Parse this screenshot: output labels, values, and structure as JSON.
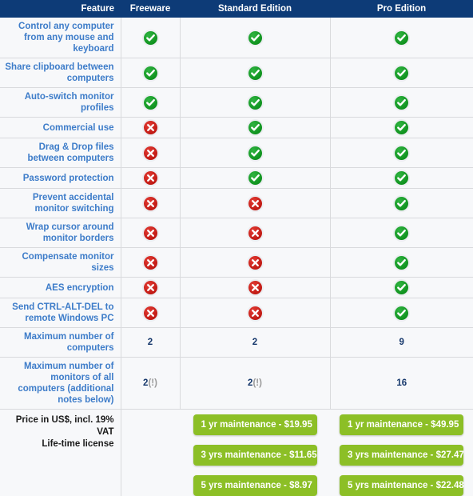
{
  "table": {
    "headers": [
      {
        "label": "Feature",
        "name": "feature"
      },
      {
        "label": "Freeware",
        "name": "freeware"
      },
      {
        "label": "Standard Edition",
        "name": "standard-edition"
      },
      {
        "label": "Pro Edition",
        "name": "pro-edition"
      }
    ],
    "rows": [
      {
        "feature": "Control any computer from any mouse and keyboard",
        "freeware": "check-icon",
        "standard": "check-icon",
        "pro": "check-icon"
      },
      {
        "feature": "Share clipboard between computers",
        "freeware": "check-icon",
        "standard": "check-icon",
        "pro": "check-icon"
      },
      {
        "feature": "Auto-switch monitor profiles",
        "freeware": "check-icon",
        "standard": "check-icon",
        "pro": "check-icon"
      },
      {
        "feature": "Commercial use",
        "freeware": "cross-icon",
        "standard": "check-icon",
        "pro": "check-icon"
      },
      {
        "feature": "Drag & Drop files between computers",
        "freeware": "cross-icon",
        "standard": "check-icon",
        "pro": "check-icon"
      },
      {
        "feature": "Password protection",
        "freeware": "cross-icon",
        "standard": "check-icon",
        "pro": "check-icon"
      },
      {
        "feature": "Prevent accidental monitor switching",
        "freeware": "cross-icon",
        "standard": "cross-icon",
        "pro": "check-icon"
      },
      {
        "feature": "Wrap cursor around monitor borders",
        "freeware": "cross-icon",
        "standard": "cross-icon",
        "pro": "check-icon"
      },
      {
        "feature": "Compensate monitor sizes",
        "freeware": "cross-icon",
        "standard": "cross-icon",
        "pro": "check-icon"
      },
      {
        "feature": "AES encryption",
        "freeware": "cross-icon",
        "standard": "cross-icon",
        "pro": "check-icon"
      },
      {
        "feature": "Send CTRL-ALT-DEL to remote Windows PC",
        "freeware": "cross-icon",
        "standard": "cross-icon",
        "pro": "check-icon"
      },
      {
        "feature": "Maximum number of computers",
        "freeware": "2",
        "standard": "2",
        "pro": "9"
      },
      {
        "feature": "Maximum number of monitors of all computers (additional notes below)",
        "freeware": "2(!)",
        "standard": "2(!)",
        "pro": "16"
      }
    ]
  },
  "footer": {
    "price_label_line1": "Price in US$, incl. 19% VAT",
    "price_label_line2": "Life-time license",
    "standard_buttons": [
      "1 yr maintenance - $19.95",
      "3 yrs maintenance - $11.65",
      "5 yrs maintenance - $8.97"
    ],
    "pro_buttons": [
      "1 yr maintenance - $49.95",
      "3 yrs maintenance - $27.47",
      "5 yrs maintenance - $22.48"
    ]
  },
  "colors": {
    "header_bg": "#0d3b77",
    "feature_text": "#3d7cc9",
    "button_green": "#8cbf26",
    "check_green": "#10931f",
    "cross_red": "#c11a14",
    "cell_bg": "#f7f8fa",
    "grid_line": "#d9dadd"
  }
}
